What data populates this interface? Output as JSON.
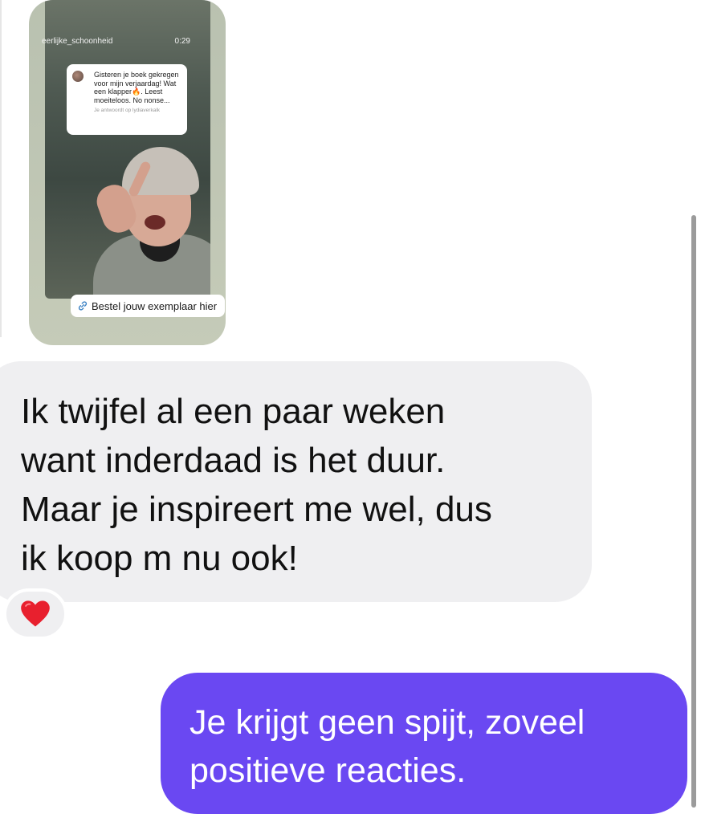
{
  "story": {
    "username": "eerlijke_schoonheid",
    "time": "0:29",
    "quote_text": "Gisteren je boek gekregen voor mijn verjaardag! Wat een klapper🔥. Leest moeiteloos. No nonse...",
    "quote_footer": "Je antwoordt op lydiaverkalk",
    "link_label": "Bestel jouw exemplaar hier"
  },
  "messages": {
    "received": {
      "text": "Ik twijfel al een paar weken\nwant inderdaad is het duur.\nMaar je inspireert me wel, dus\nik koop m nu ook!",
      "reaction": "heart-icon"
    },
    "sent": {
      "text": "Je krijgt geen spijt, zoveel\npositieve reacties."
    }
  },
  "colors": {
    "sent_bubble": "#6a48f2",
    "received_bubble": "#efeff1",
    "reaction_heart": "#e8202e",
    "link_icon": "#3b82c4"
  }
}
